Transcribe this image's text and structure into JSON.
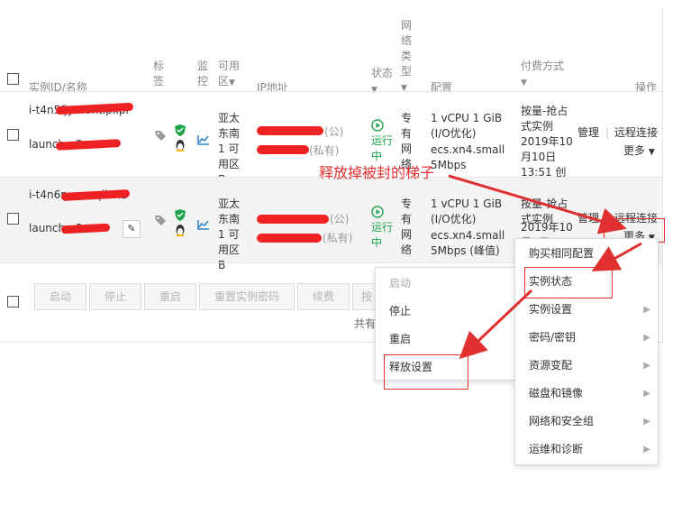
{
  "header": {
    "col_id": "实例ID/名称",
    "col_tag": "标签",
    "col_monitor": "监控",
    "col_zone": "可用区",
    "col_zone_caret": "▼",
    "col_ip": "IP地址",
    "col_status": "状态",
    "col_status_caret": "▼",
    "col_network": "网络类型",
    "col_network_caret": "▼",
    "col_config": "配置",
    "col_billing": "付费方式",
    "col_billing_caret": "▼",
    "col_actions": "操作"
  },
  "rows": [
    {
      "id": "i-t4n5fjy…0ntlpxpi",
      "name": "launch…2…",
      "zone": "亚太东南 1 可用区 B",
      "ip_public": "(公)",
      "ip_private": "(私有)",
      "status": "运行中",
      "network": "专有网络",
      "config": "1 vCPU 1 GiB (I/O优化)",
      "instance_type": "ecs.xn4.small",
      "bandwidth": "5Mbps",
      "billing": "按量-抢占式实例",
      "created": "2019年10月10日 13:51 创建",
      "manage": "管理",
      "remote": "远程连接",
      "more": "更多"
    },
    {
      "id": "i-t4n6n…smqliax1",
      "name": "launch…2…",
      "zone": "亚太东南 1 可用区 B",
      "ip_public": "(公)",
      "ip_private": "(私有)",
      "status": "运行中",
      "network": "专有网络",
      "config": "1 vCPU 1 GiB (I/O优化)",
      "instance_type": "ecs.xn4.small",
      "bandwidth": "5Mbps (峰值)",
      "billing": "按量-抢占式实例",
      "created": "2019年10月9日",
      "manage": "管理",
      "remote": "远程连接",
      "more": "更多"
    }
  ],
  "bottom_buttons": [
    "启动",
    "停止",
    "重启",
    "重置实例密码",
    "续费",
    "按"
  ],
  "footer_text": "共有",
  "annotation": "释放掉被封的梯子",
  "left_menu": [
    "启动",
    "停止",
    "重启",
    "释放设置"
  ],
  "right_menu": [
    "购买相同配置",
    "实例状态",
    "实例设置",
    "密码/密钥",
    "资源变配",
    "磁盘和镜像",
    "网络和安全组",
    "运维和诊断"
  ],
  "right_menu_submenu": [
    false,
    false,
    true,
    true,
    true,
    true,
    true,
    true
  ],
  "colors": {
    "link": "#0a6fc2",
    "running": "#1fa34a",
    "annotation": "#e03030"
  }
}
